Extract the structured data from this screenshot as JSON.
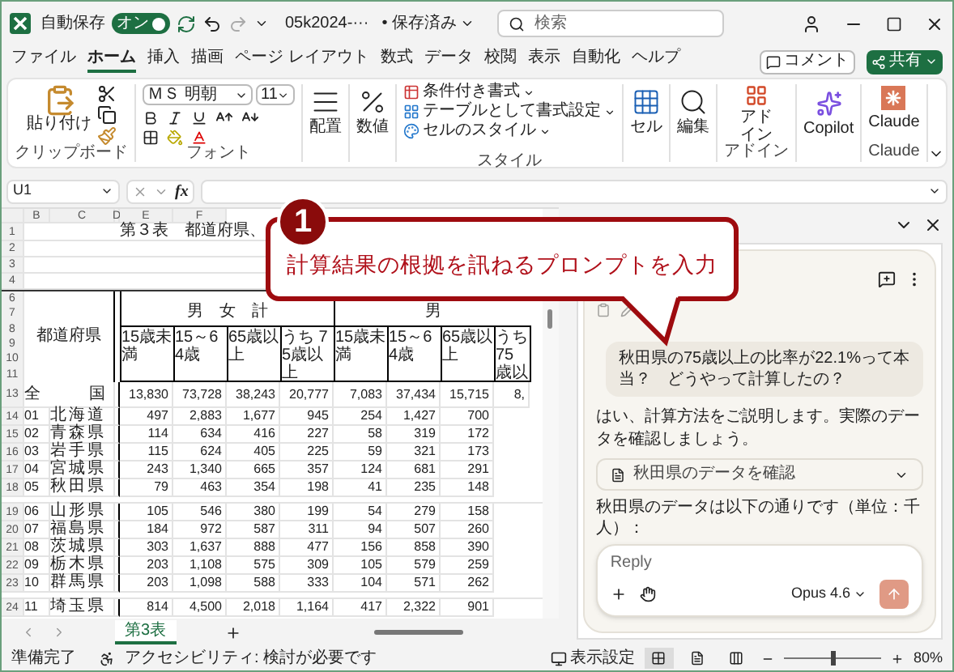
{
  "titlebar": {
    "autosave_label": "自動保存",
    "autosave": {
      "label": "オン",
      "on": true
    },
    "filename": "05k2024-···",
    "save_status": "• 保存済み",
    "search_placeholder": "検索"
  },
  "ribbon_tabs": [
    {
      "label": "ファイル",
      "selected": false
    },
    {
      "label": "ホーム",
      "selected": true
    },
    {
      "label": "挿入",
      "selected": false
    },
    {
      "label": "描画",
      "selected": false
    },
    {
      "label": "ページ レイアウト",
      "selected": false
    },
    {
      "label": "数式",
      "selected": false
    },
    {
      "label": "データ",
      "selected": false
    },
    {
      "label": "校閲",
      "selected": false
    },
    {
      "label": "表示",
      "selected": false
    },
    {
      "label": "自動化",
      "selected": false
    },
    {
      "label": "ヘルプ",
      "selected": false
    }
  ],
  "comment_button": "コメント",
  "share_button": "共有",
  "ribbon": {
    "clipboard": {
      "paste": "貼り付け",
      "group": "クリップボード"
    },
    "font": {
      "name": "ＭＳ 明朝",
      "size": "11",
      "group": "フォント"
    },
    "alignment": "配置",
    "number": "数値",
    "styles": {
      "items": [
        "条件付き書式",
        "テーブルとして書式設定",
        "セルのスタイル"
      ],
      "group": "スタイル"
    },
    "cells": "セル",
    "editing": "編集",
    "addins": {
      "button": "アドイン",
      "group": "アドイン"
    },
    "copilot": "Copilot",
    "claude": {
      "button": "Claude",
      "group": "Claude"
    }
  },
  "formula_bar": {
    "name_box": "U1",
    "fx": "fx"
  },
  "sheet": {
    "column_headers": [
      "B",
      "C",
      "D",
      "E",
      "F"
    ],
    "title_row": "1",
    "title": "第３表　都道府県、",
    "blank_rows": [
      "2",
      "3",
      "4"
    ],
    "header_rows": [
      "6",
      "7",
      "8",
      "9",
      "10",
      "11"
    ],
    "region_header": "都道府県",
    "group_headers": [
      "男　女　計",
      "男"
    ],
    "subheaders": [
      "15歳未満",
      "15～64歳",
      "65歳以上",
      "うち 75歳以上",
      "15歳未満",
      "15～64歳",
      "65歳以上",
      "うち 75歳以"
    ],
    "total_row": {
      "row": "13",
      "name": "全　　　国",
      "values": [
        "13,830",
        "73,728",
        "38,243",
        "20,777",
        "7,083",
        "37,434",
        "15,715",
        "8,"
      ]
    },
    "blocks": [
      [
        {
          "row": "14",
          "code": "01",
          "name": "北海道",
          "values": [
            "497",
            "2,883",
            "1,677",
            "945",
            "254",
            "1,427",
            "700"
          ]
        },
        {
          "row": "15",
          "code": "02",
          "name": "青森県",
          "values": [
            "114",
            "634",
            "416",
            "227",
            "58",
            "319",
            "172"
          ]
        },
        {
          "row": "16",
          "code": "03",
          "name": "岩手県",
          "values": [
            "115",
            "624",
            "405",
            "225",
            "59",
            "321",
            "173"
          ]
        },
        {
          "row": "17",
          "code": "04",
          "name": "宮城県",
          "values": [
            "243",
            "1,340",
            "665",
            "357",
            "124",
            "681",
            "291"
          ]
        },
        {
          "row": "18",
          "code": "05",
          "name": "秋田県",
          "values": [
            "79",
            "463",
            "354",
            "198",
            "41",
            "235",
            "148"
          ]
        }
      ],
      [
        {
          "row": "19",
          "code": "06",
          "name": "山形県",
          "values": [
            "105",
            "546",
            "380",
            "199",
            "54",
            "279",
            "158"
          ]
        },
        {
          "row": "20",
          "code": "07",
          "name": "福島県",
          "values": [
            "184",
            "972",
            "587",
            "311",
            "94",
            "507",
            "260"
          ]
        },
        {
          "row": "21",
          "code": "08",
          "name": "茨城県",
          "values": [
            "303",
            "1,637",
            "888",
            "477",
            "156",
            "858",
            "390"
          ]
        },
        {
          "row": "22",
          "code": "09",
          "name": "栃木県",
          "values": [
            "203",
            "1,108",
            "575",
            "309",
            "105",
            "579",
            "259"
          ]
        },
        {
          "row": "23",
          "code": "10",
          "name": "群馬県",
          "values": [
            "203",
            "1,098",
            "588",
            "333",
            "104",
            "571",
            "262"
          ]
        }
      ],
      [
        {
          "row": "24",
          "code": "11",
          "name": "埼玉県",
          "values": [
            "814",
            "4,500",
            "2,018",
            "1,164",
            "417",
            "2,322",
            "901"
          ]
        }
      ]
    ]
  },
  "sheet_tabs": [
    {
      "label": "第3表",
      "selected": true
    }
  ],
  "claude_panel": {
    "user_message": "秋田県の75歳以上の比率が22.1%って本当？　どうやって計算したの？",
    "assistant_text": "はい、計算方法をご説明します。実際のデータを確認しましょう。",
    "tool_step": "秋田県のデータを確認",
    "assistant_text_2": "秋田県のデータは以下の通りです（単位：千人）：",
    "reply_placeholder": "Reply",
    "model": "Opus 4.6"
  },
  "callout": {
    "step": "1",
    "text": "計算結果の根拠を訊ねるプロンプトを入力"
  },
  "status_bar": {
    "ready": "準備完了",
    "accessibility": "アクセシビリティ: 検討が必要です",
    "display_settings": "表示設定",
    "views": [
      {
        "kind": "normal",
        "selected": true
      },
      {
        "kind": "page_layout",
        "selected": false
      },
      {
        "kind": "page_break",
        "selected": false
      }
    ],
    "zoom": {
      "level": 0.5,
      "label": "80%"
    }
  }
}
